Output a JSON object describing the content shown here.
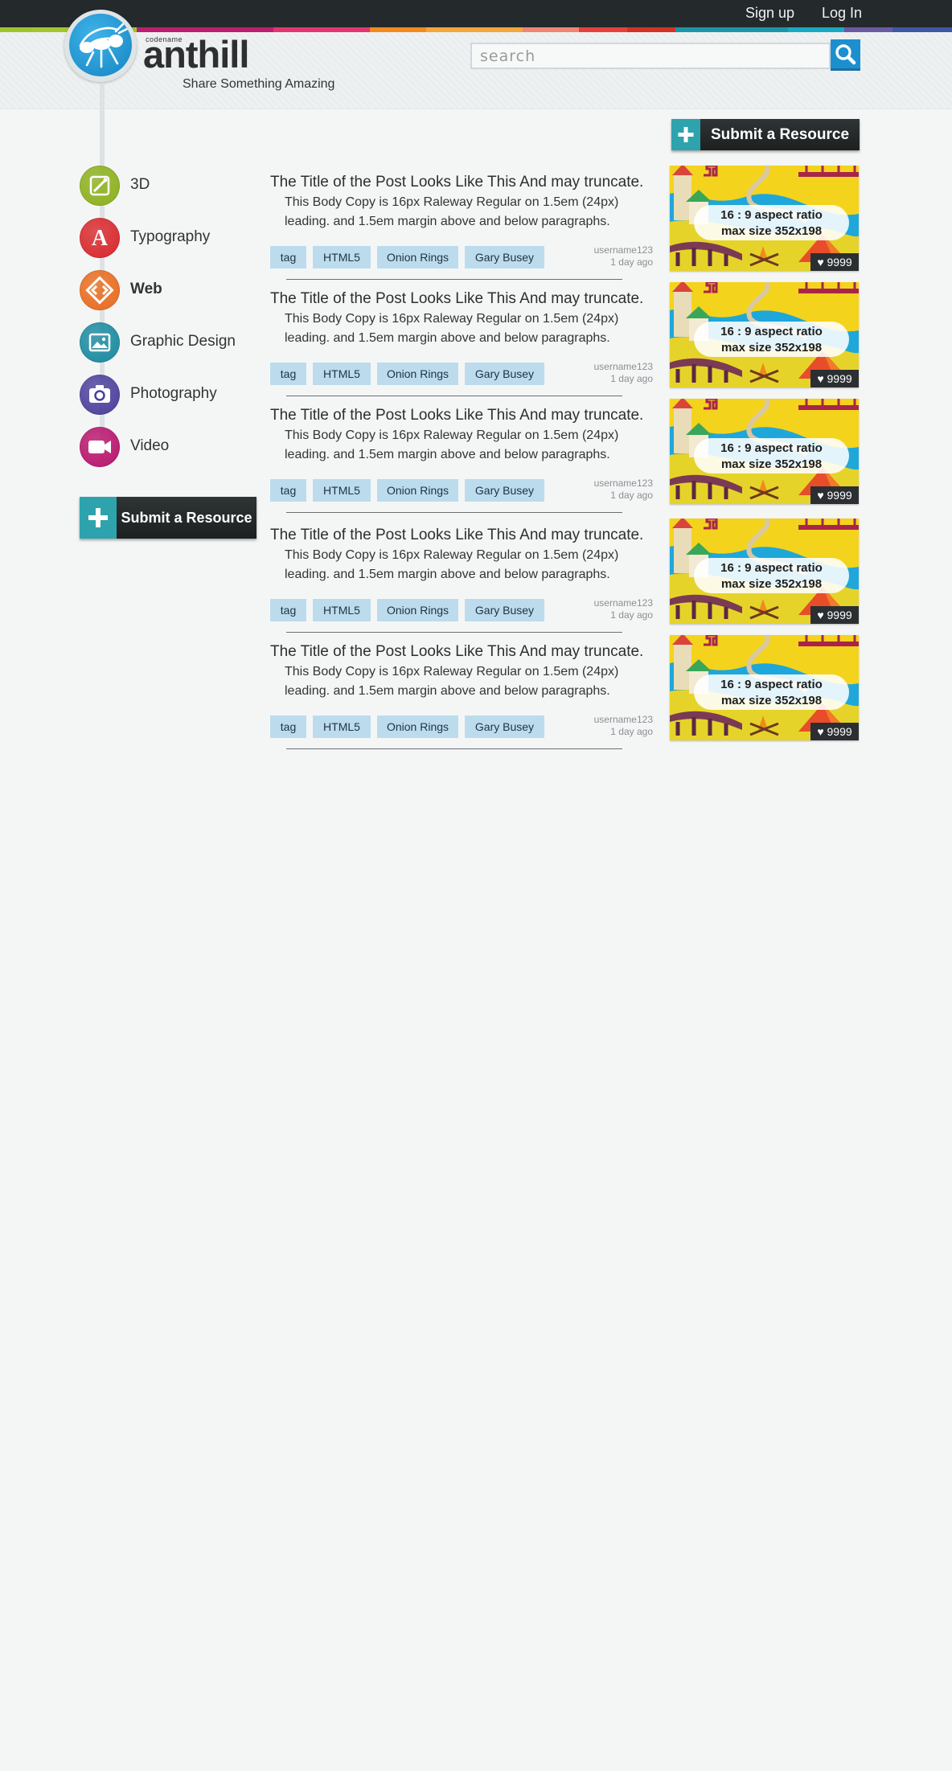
{
  "colors": {
    "topbar": "#24292b",
    "accent_blue": "#1c8fcf",
    "submit_plus": "#2ea3ad",
    "tag_bg": "#bcdcee",
    "stripe": [
      "#9dc52a",
      "#a3c52f",
      "#bd1e71",
      "#e2356f",
      "#f28b1c",
      "#f4a63a",
      "#f08577",
      "#e6403d",
      "#d23424",
      "#1a96a8",
      "#18a9c3",
      "#6a5aa2",
      "#3f57a6"
    ]
  },
  "header": {
    "signup_label": "Sign up",
    "login_label": "Log In",
    "codename": "codename",
    "brand": "anthill",
    "tagline": "Share Something Amazing",
    "logo_icon": "ant-icon",
    "search_placeholder": "search",
    "search_icon": "search-icon"
  },
  "submit": {
    "label": "Submit a Resource",
    "icon": "plus-icon"
  },
  "categories": [
    {
      "label": "3D",
      "icon": "wand-icon",
      "color": "#8cb01b",
      "active": false
    },
    {
      "label": "Typography",
      "icon": "letter-a-icon",
      "color": "#d8262b",
      "active": false
    },
    {
      "label": "Web",
      "icon": "code-icon",
      "color": "#e86b1e",
      "active": true
    },
    {
      "label": "Graphic Design",
      "icon": "image-icon",
      "color": "#198aa0",
      "active": false
    },
    {
      "label": "Photography",
      "icon": "camera-icon",
      "color": "#4a3f9b",
      "active": false
    },
    {
      "label": "Video",
      "icon": "video-camera-icon",
      "color": "#b8146b",
      "active": false
    }
  ],
  "posts": [
    {
      "title": "The Title of the Post Looks Like This And may truncate.",
      "body_line1": "This Body Copy is 16px Raleway Regular on 1.5em (24px)",
      "body_line2": "leading.  and 1.5em margin above and below paragraphs.",
      "tags": [
        "tag",
        "HTML5",
        "Onion Rings",
        "Gary Busey"
      ],
      "username": "username123",
      "time": "1 day ago",
      "thumb_line1": "16 : 9 aspect ratio",
      "thumb_line2": "max size 352x198",
      "likes": "9999"
    },
    {
      "title": "The Title of the Post Looks Like This And may truncate.",
      "body_line1": "This Body Copy is 16px Raleway Regular on 1.5em (24px)",
      "body_line2": "leading.  and 1.5em margin above and below paragraphs.",
      "tags": [
        "tag",
        "HTML5",
        "Onion Rings",
        "Gary Busey"
      ],
      "username": "username123",
      "time": "1 day ago",
      "thumb_line1": "16 : 9 aspect ratio",
      "thumb_line2": "max size 352x198",
      "likes": "9999"
    },
    {
      "title": "The Title of the Post Looks Like This And may truncate.",
      "body_line1": "This Body Copy is 16px Raleway Regular on 1.5em (24px)",
      "body_line2": "leading.  and 1.5em margin above and below paragraphs.",
      "tags": [
        "tag",
        "HTML5",
        "Onion Rings",
        "Gary Busey"
      ],
      "username": "username123",
      "time": "1 day ago",
      "thumb_line1": "16 : 9 aspect ratio",
      "thumb_line2": "max size 352x198",
      "likes": "9999"
    },
    {
      "title": "The Title of the Post Looks Like This And may truncate.",
      "body_line1": "This Body Copy is 16px Raleway Regular on 1.5em (24px)",
      "body_line2": "leading.  and 1.5em margin above and below paragraphs.",
      "tags": [
        "tag",
        "HTML5",
        "Onion Rings",
        "Gary Busey"
      ],
      "username": "username123",
      "time": "1 day ago",
      "thumb_line1": "16 : 9 aspect ratio",
      "thumb_line2": "max size 352x198",
      "likes": "9999"
    },
    {
      "title": "The Title of the Post Looks Like This And may truncate.",
      "body_line1": "This Body Copy is 16px Raleway Regular on 1.5em (24px)",
      "body_line2": "leading.  and 1.5em margin above and below paragraphs.",
      "tags": [
        "tag",
        "HTML5",
        "Onion Rings",
        "Gary Busey"
      ],
      "username": "username123",
      "time": "1 day ago",
      "thumb_line1": "16 : 9 aspect ratio",
      "thumb_line2": "max size 352x198",
      "likes": "9999"
    }
  ]
}
